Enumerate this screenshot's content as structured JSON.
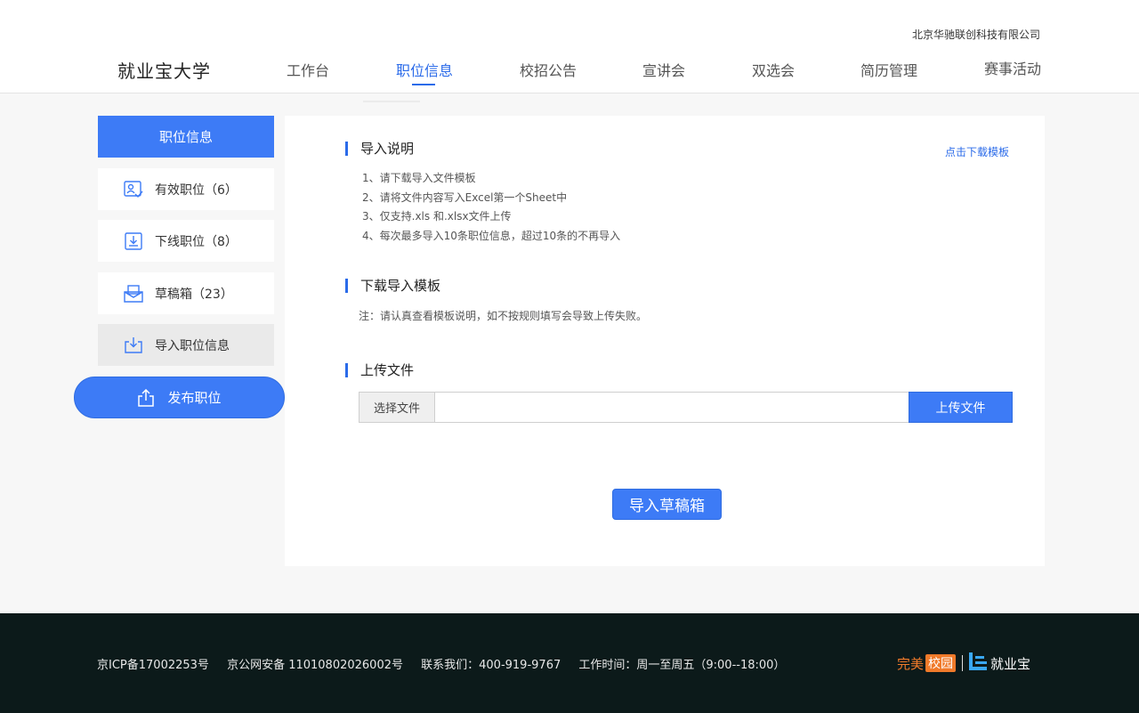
{
  "header": {
    "company": "北京华驰联创科技有限公司",
    "brand": "就业宝大学",
    "nav": [
      {
        "label": "工作台"
      },
      {
        "label": "职位信息"
      },
      {
        "label": "校招公告"
      },
      {
        "label": "宣讲会"
      },
      {
        "label": "双选会"
      },
      {
        "label": "简历管理"
      },
      {
        "label": "赛事活动"
      }
    ],
    "active_nav": "职位信息"
  },
  "sidebar": {
    "title": "职位信息",
    "items": [
      {
        "label": "有效职位（6）",
        "icon": "valid-position-icon"
      },
      {
        "label": "下线职位（8）",
        "icon": "download-tray-icon"
      },
      {
        "label": "草稿箱（23）",
        "icon": "draft-box-icon"
      },
      {
        "label": "导入职位信息",
        "icon": "import-icon"
      }
    ],
    "selected": "导入职位信息",
    "publish_label": "发布职位"
  },
  "main": {
    "section1_title": "导入说明",
    "download_link": "点击下载模板",
    "instructions": [
      "1、请下载导入文件模板",
      "2、请将文件内容写入Excel第一个Sheet中",
      "3、仅支持.xls 和.xlsx文件上传",
      "4、每次最多导入10条职位信息，超过10条的不再导入"
    ],
    "section2_title": "下载导入模板",
    "note": "注：请认真查看模板说明，如不按规则填写会导致上传失败。",
    "section3_title": "上传文件",
    "choose_file_label": "选择文件",
    "file_value": "",
    "upload_label": "上传文件",
    "import_label": "导入草稿箱"
  },
  "footer": {
    "icp": "京ICP备17002253号",
    "police": "京公网安备 11010802026002号",
    "contact": "联系我们：400-919-9767",
    "hours": "工作时间：周一至周五（9:00--18:00）",
    "logo_left_text": "完美",
    "logo_left_box": "校园",
    "logo_right_text": "就业宝"
  },
  "colors": {
    "accent": "#3d7bf6",
    "link": "#2b6be9",
    "footer_bg": "#0c1a1a",
    "logo_orange": "#f07a2a"
  }
}
